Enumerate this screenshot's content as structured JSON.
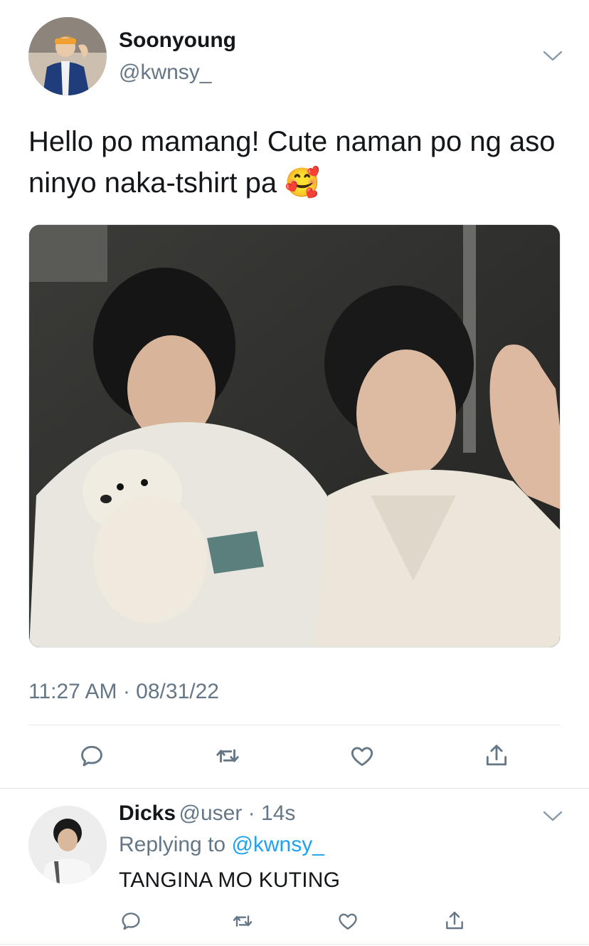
{
  "tweet": {
    "author": {
      "display_name": "Soonyoung",
      "handle": "@kwnsy_",
      "avatar_icon": "profile-photo"
    },
    "text": "Hello po mamang! Cute naman po ng aso ninyo naka-tshirt pa",
    "emoji": "🥰",
    "media_icon": "photo-two-people-with-pomeranian",
    "timestamp": "11:27 AM · 08/31/22",
    "actions": {
      "reply_icon": "speech-bubble-icon",
      "retweet_icon": "retweet-icon",
      "like_icon": "heart-icon",
      "share_icon": "share-icon"
    }
  },
  "reply": {
    "author": {
      "display_name": "Dicks",
      "handle": "@user",
      "time": "14s",
      "avatar_icon": "profile-photo"
    },
    "replying_prefix": "Replying to",
    "replying_to": "@kwnsy_",
    "text": "TANGINA MO KUTING"
  },
  "colors": {
    "text_primary": "#14171a",
    "text_secondary": "#657786",
    "link": "#1da1f2",
    "divider": "#e1e8ed"
  }
}
